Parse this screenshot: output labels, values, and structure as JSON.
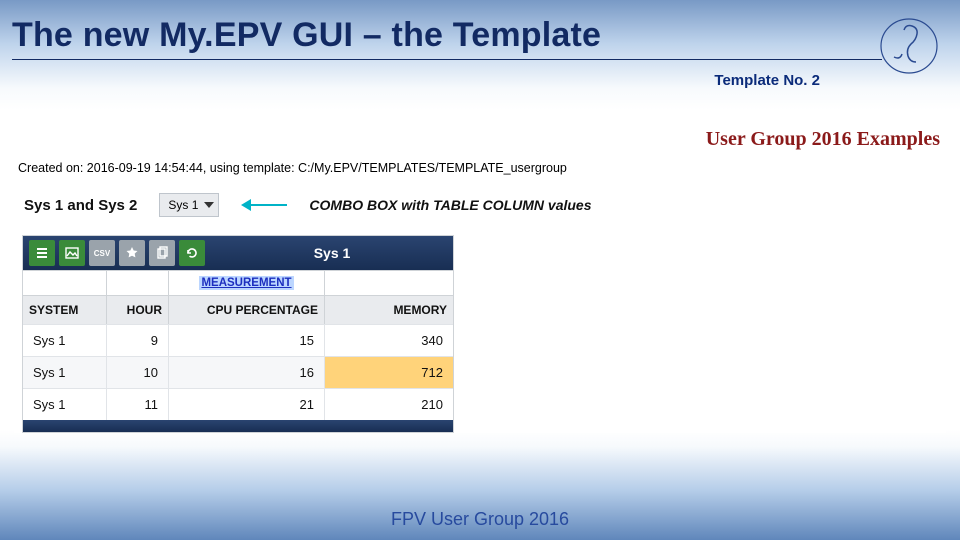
{
  "slide": {
    "title": "The new My.EPV GUI – the Template",
    "template_no": "Template No. 2"
  },
  "panel": {
    "user_group_title": "User Group 2016 Examples",
    "created_on": "Created on: 2016-09-19 14:54:44, using template: C:/My.EPV/TEMPLATES/TEMPLATE_usergroup",
    "combo": {
      "label": "Sys 1 and Sys 2",
      "value": "Sys 1",
      "note": "COMBO BOX with TABLE COLUMN values"
    },
    "table": {
      "title": "Sys 1",
      "group_header": "MEASUREMENT",
      "columns": [
        "SYSTEM",
        "HOUR",
        "CPU PERCENTAGE",
        "MEMORY"
      ],
      "rows": [
        {
          "system": "Sys 1",
          "hour": 9,
          "cpu": 15,
          "memory": 340,
          "memory_highlight": false
        },
        {
          "system": "Sys 1",
          "hour": 10,
          "cpu": 16,
          "memory": 712,
          "memory_highlight": true
        },
        {
          "system": "Sys 1",
          "hour": 11,
          "cpu": 21,
          "memory": 210,
          "memory_highlight": false
        }
      ],
      "toolbar_icons": [
        "list-icon",
        "image-icon",
        "csv-icon",
        "star-icon",
        "copy-icon",
        "refresh-icon"
      ]
    }
  },
  "footer": "FPV User Group 2016"
}
